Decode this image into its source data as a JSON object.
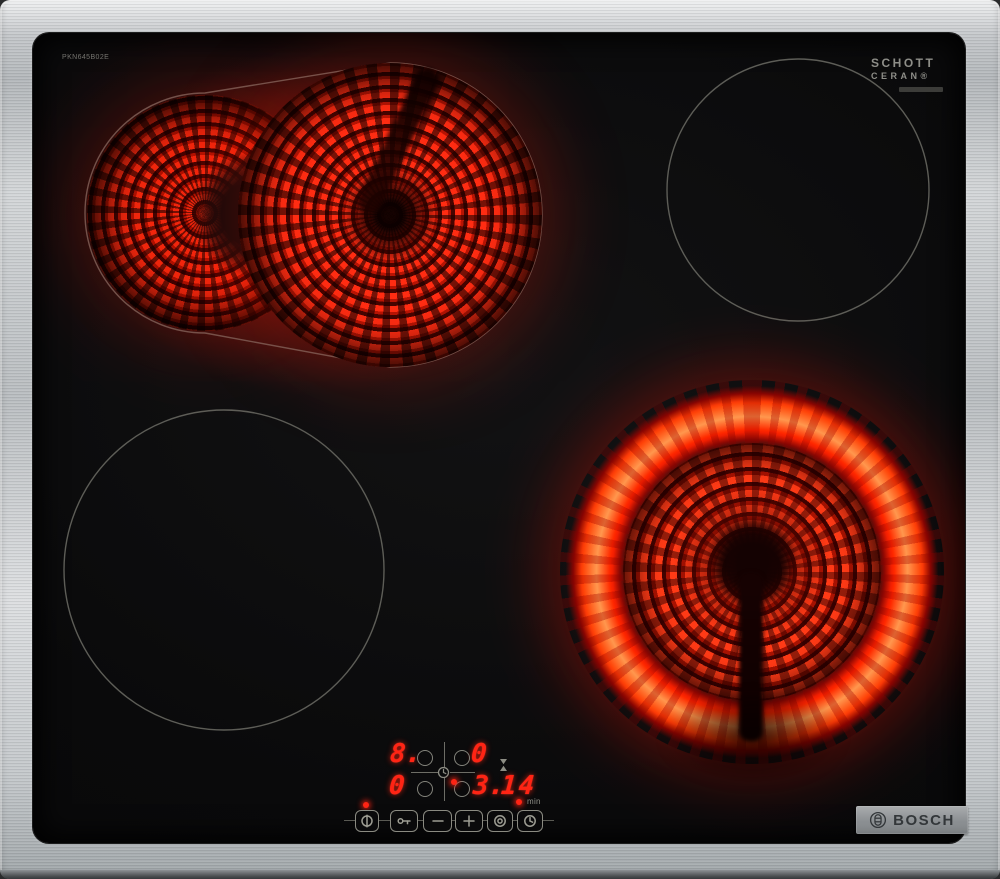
{
  "branding": {
    "model_number": "PKN645B02E",
    "glass_logo_line1": "SCHOTT",
    "glass_logo_line2": "CERAN®",
    "frame_logo": "BOSCH"
  },
  "zones": {
    "rear_left": {
      "state": "on",
      "type": "dual-extendable"
    },
    "rear_right": {
      "state": "off",
      "type": "single"
    },
    "front_left": {
      "state": "off",
      "type": "single"
    },
    "front_right": {
      "state": "on",
      "type": "single"
    }
  },
  "control_panel": {
    "zone_displays": {
      "rear_left": "8.",
      "rear_right": "0",
      "front_left": "0",
      "front_right": "3."
    },
    "timer": {
      "value": "14",
      "unit": "min"
    },
    "indicators": {
      "power_led": "on",
      "timer_led": "on",
      "zone_select_led": "on"
    },
    "buttons": [
      {
        "id": "power",
        "icon": "power-icon"
      },
      {
        "id": "key-lock",
        "icon": "key-icon"
      },
      {
        "id": "minus",
        "icon": "minus-icon"
      },
      {
        "id": "plus",
        "icon": "plus-icon"
      },
      {
        "id": "dual-zone",
        "icon": "dual-circle-icon"
      },
      {
        "id": "timer",
        "icon": "clock-icon"
      }
    ]
  },
  "colors": {
    "display_red": "#ff2414",
    "steel": "#c6c9cb",
    "glass_black": "#0a0a0b",
    "outline_grey": "#66665f",
    "hot_coil_red": "#ff2c12"
  }
}
